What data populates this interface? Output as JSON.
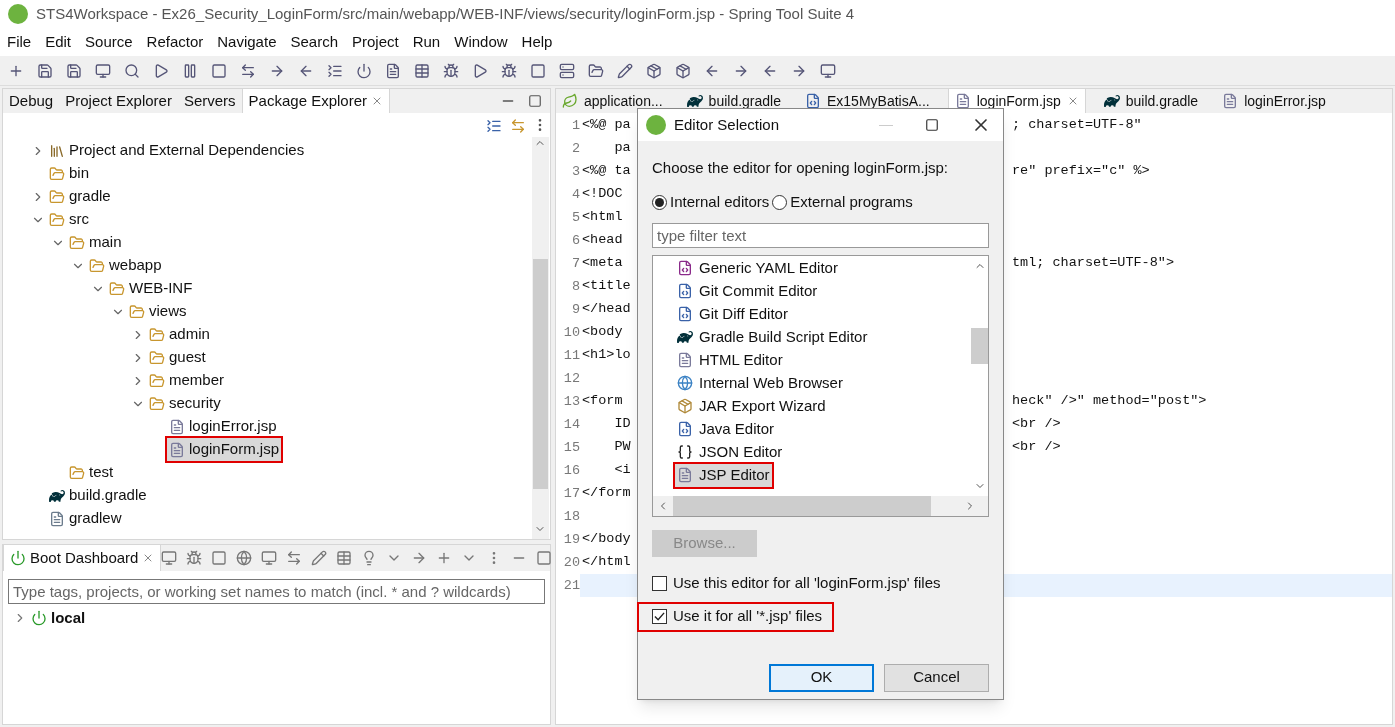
{
  "window": {
    "title": "STS4Workspace - Ex26_Security_LoginForm/src/main/webapp/WEB-INF/views/security/loginForm.jsp - Spring Tool Suite 4"
  },
  "menu": [
    "File",
    "Edit",
    "Source",
    "Refactor",
    "Navigate",
    "Search",
    "Project",
    "Run",
    "Window",
    "Help"
  ],
  "left_tabs": [
    {
      "label": "Debug",
      "selected": false
    },
    {
      "label": "Project Explorer",
      "selected": false
    },
    {
      "label": "Servers",
      "selected": false
    },
    {
      "label": "Package Explorer",
      "selected": true
    }
  ],
  "tree": [
    {
      "label": "Project and External Dependencies",
      "kind": "library",
      "has_children": true,
      "expanded": false,
      "selected": false,
      "annotated": false
    },
    {
      "label": "bin",
      "kind": "folder",
      "has_children": false,
      "expanded": false,
      "selected": false,
      "annotated": false
    },
    {
      "label": "gradle",
      "kind": "folder",
      "has_children": true,
      "expanded": false,
      "selected": false,
      "annotated": false
    },
    {
      "label": "src",
      "kind": "folder",
      "has_children": true,
      "expanded": true,
      "selected": false,
      "annotated": false,
      "children": [
        {
          "label": "main",
          "kind": "folder",
          "has_children": true,
          "expanded": true,
          "selected": false,
          "annotated": false,
          "children": [
            {
              "label": "webapp",
              "kind": "folder",
              "has_children": true,
              "expanded": true,
              "selected": false,
              "annotated": false,
              "children": [
                {
                  "label": "WEB-INF",
                  "kind": "folder",
                  "has_children": true,
                  "expanded": true,
                  "selected": false,
                  "annotated": false,
                  "children": [
                    {
                      "label": "views",
                      "kind": "folder",
                      "has_children": true,
                      "expanded": true,
                      "selected": false,
                      "annotated": false,
                      "children": [
                        {
                          "label": "admin",
                          "kind": "folder",
                          "has_children": true,
                          "expanded": false,
                          "selected": false,
                          "annotated": false
                        },
                        {
                          "label": "guest",
                          "kind": "folder",
                          "has_children": true,
                          "expanded": false,
                          "selected": false,
                          "annotated": false
                        },
                        {
                          "label": "member",
                          "kind": "folder",
                          "has_children": true,
                          "expanded": false,
                          "selected": false,
                          "annotated": false
                        },
                        {
                          "label": "security",
                          "kind": "folder",
                          "has_children": true,
                          "expanded": true,
                          "selected": false,
                          "annotated": false,
                          "children": [
                            {
                              "label": "loginError.jsp",
                              "kind": "file",
                              "has_children": false,
                              "expanded": false,
                              "selected": false,
                              "annotated": false
                            },
                            {
                              "label": "loginForm.jsp",
                              "kind": "file",
                              "has_children": false,
                              "expanded": false,
                              "selected": true,
                              "annotated": true
                            }
                          ]
                        }
                      ]
                    }
                  ]
                }
              ]
            }
          ]
        },
        {
          "label": "test",
          "kind": "folder",
          "has_children": false,
          "expanded": false,
          "selected": false,
          "annotated": false
        }
      ]
    },
    {
      "label": "build.gradle",
      "kind": "gradle",
      "has_children": false,
      "expanded": false,
      "selected": false,
      "annotated": false
    },
    {
      "label": "gradlew",
      "kind": "text",
      "has_children": false,
      "expanded": false,
      "selected": false,
      "annotated": false
    }
  ],
  "boot_dashboard": {
    "tab": "Boot Dashboard",
    "filter_placeholder": "Type tags, projects, or working set names to match (incl. * and ? wildcards)",
    "items": [
      {
        "label": "local",
        "expanded": false
      }
    ]
  },
  "editor_tabs": [
    {
      "label": "application...",
      "kind": "leaf",
      "selected": false
    },
    {
      "label": "build.gradle",
      "kind": "gradle",
      "selected": false
    },
    {
      "label": "Ex15MyBatisA...",
      "kind": "java",
      "selected": false
    },
    {
      "label": "loginForm.jsp",
      "kind": "file",
      "selected": true
    },
    {
      "label": "build.gradle",
      "kind": "gradle",
      "selected": false
    },
    {
      "label": "loginError.jsp",
      "kind": "file",
      "selected": false
    }
  ],
  "code_lines": [
    {
      "number": "1",
      "left": "<%@ pa",
      "right": "; charset=UTF-8\"",
      "current": false
    },
    {
      "number": "2",
      "left": "    pa",
      "current": false
    },
    {
      "number": "3",
      "left": "<%@ ta",
      "right": "re\" prefix=\"c\" %>",
      "current": false
    },
    {
      "number": "4",
      "left": "<!DOC",
      "current": false
    },
    {
      "number": "5",
      "left": "<html",
      "current": false
    },
    {
      "number": "6",
      "left": "<head",
      "current": false
    },
    {
      "number": "7",
      "left": "<meta",
      "right": "tml; charset=UTF-8\">",
      "current": false
    },
    {
      "number": "8",
      "left": "<title",
      "current": false
    },
    {
      "number": "9",
      "left": "</head",
      "current": false
    },
    {
      "number": "10",
      "left": "<body",
      "current": false
    },
    {
      "number": "11",
      "left": "<h1>lo",
      "current": false
    },
    {
      "number": "12",
      "current": false
    },
    {
      "number": "13",
      "left": "<form",
      "right": "heck\" />\" method=\"post\">",
      "current": false
    },
    {
      "number": "14",
      "left": "    ID",
      "right": "<br />",
      "current": false
    },
    {
      "number": "15",
      "left": "    PW",
      "right": "<br />",
      "current": false
    },
    {
      "number": "16",
      "left": "    <i",
      "current": false
    },
    {
      "number": "17",
      "left": "</form",
      "current": false
    },
    {
      "number": "18",
      "current": false
    },
    {
      "number": "19",
      "left": "</body",
      "current": false
    },
    {
      "number": "20",
      "left": "</html",
      "current": false
    },
    {
      "number": "21",
      "current": true
    }
  ],
  "dialog": {
    "title": "Editor Selection",
    "prompt": "Choose the editor for opening loginForm.jsp:",
    "radios": [
      {
        "label": "Internal editors",
        "selected": true
      },
      {
        "label": "External programs",
        "selected": false
      }
    ],
    "filter_placeholder": "type filter text",
    "editors": [
      {
        "label": "Generic YAML Editor",
        "kind": "yaml",
        "selected": false,
        "annotated": false
      },
      {
        "label": "Git Commit Editor",
        "kind": "git",
        "selected": false,
        "annotated": false
      },
      {
        "label": "Git Diff Editor",
        "kind": "git",
        "selected": false,
        "annotated": false
      },
      {
        "label": "Gradle Build Script Editor",
        "kind": "gradle",
        "selected": false,
        "annotated": false
      },
      {
        "label": "HTML Editor",
        "kind": "file",
        "selected": false,
        "annotated": false
      },
      {
        "label": "Internal Web Browser",
        "kind": "globe",
        "selected": false,
        "annotated": false
      },
      {
        "label": "JAR Export Wizard",
        "kind": "jar",
        "selected": false,
        "annotated": false
      },
      {
        "label": "Java Editor",
        "kind": "java",
        "selected": false,
        "annotated": false
      },
      {
        "label": "JSON Editor",
        "kind": "braces",
        "selected": false,
        "annotated": false
      },
      {
        "label": "JSP Editor",
        "kind": "file",
        "selected": true,
        "annotated": true
      }
    ],
    "browse": {
      "label": "Browse...",
      "disabled": true
    },
    "options": [
      {
        "label": "Use this editor for all 'loginForm.jsp' files",
        "checked": false,
        "annotated": false
      },
      {
        "label": "Use it for all '*.jsp' files",
        "checked": true,
        "annotated": true
      }
    ],
    "buttons": [
      {
        "label": "OK",
        "default": true
      },
      {
        "label": "Cancel",
        "default": false
      }
    ]
  }
}
